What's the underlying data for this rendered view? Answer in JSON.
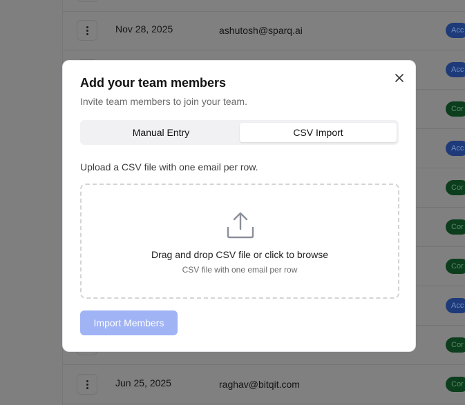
{
  "background_table": {
    "rows": [
      {
        "date": "",
        "email": "",
        "badge": ""
      },
      {
        "date": "Nov 28, 2025",
        "email": "ashutosh@sparq.ai",
        "badge": "Acc",
        "badge_color": "blue"
      },
      {
        "date": "",
        "email": "",
        "badge": "Acc",
        "badge_color": "blue"
      },
      {
        "date": "",
        "email": "",
        "badge": "Cor",
        "badge_color": "green"
      },
      {
        "date": "",
        "email": "",
        "badge": "Acc",
        "badge_color": "blue"
      },
      {
        "date": "",
        "email": "",
        "badge": "Cor",
        "badge_color": "green"
      },
      {
        "date": "",
        "email": "",
        "badge": "Cor",
        "badge_color": "green"
      },
      {
        "date": "",
        "email": "",
        "badge": "Cor",
        "badge_color": "green"
      },
      {
        "date": "",
        "email": "",
        "badge": "Acc",
        "badge_color": "blue"
      },
      {
        "date": "",
        "email": "",
        "badge": "Cor",
        "badge_color": "green"
      },
      {
        "date": "Jun 25, 2025",
        "email": "raghav@bitqit.com",
        "badge": "Cor",
        "badge_color": "green"
      }
    ]
  },
  "modal": {
    "title": "Add your team members",
    "subtitle": "Invite team members to join your team.",
    "tabs": [
      {
        "label": "Manual Entry",
        "active": false
      },
      {
        "label": "CSV Import",
        "active": true
      }
    ],
    "upload_hint": "Upload a CSV file with one email per row.",
    "dropzone": {
      "icon": "upload-icon",
      "main_text": "Drag and drop CSV file or click to browse",
      "sub_text": "CSV file with one email per row"
    },
    "import_button": "Import Members",
    "close_icon": "close-icon"
  },
  "colors": {
    "overlay": "#7f7f7f",
    "import_button_bg": "#9fb3f5",
    "badge_blue": "#1e3a78",
    "badge_green": "#0c3d1c"
  }
}
